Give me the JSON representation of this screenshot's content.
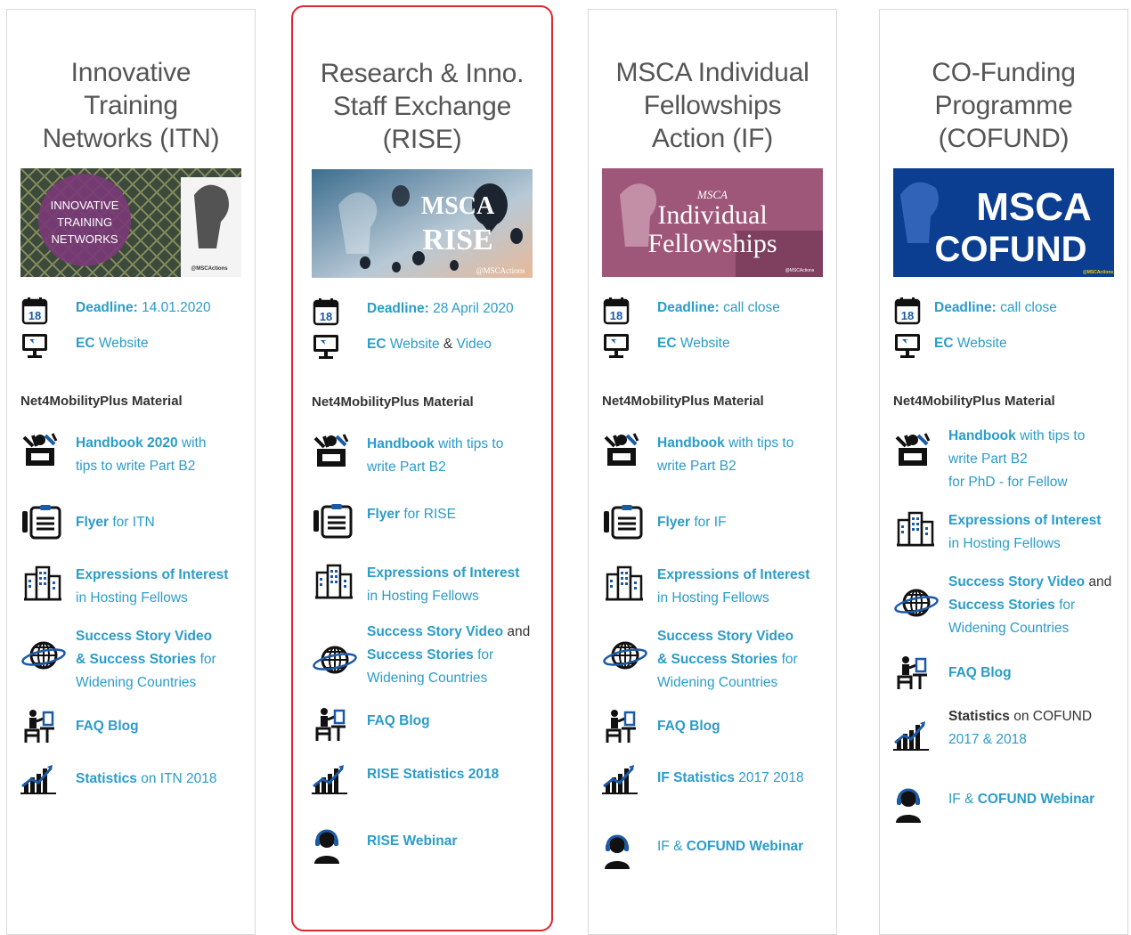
{
  "columns": [
    {
      "title_lines": [
        "Innovative",
        "Training",
        "Networks (ITN)"
      ],
      "banner_text": [
        "INNOVATIVE",
        "TRAINING",
        "NETWORKS"
      ],
      "banner_handle": "@MSCActions",
      "deadline_label": "Deadline:",
      "deadline_value": " 14.01.2020",
      "website_ec": "EC",
      "website_text": " Website",
      "section": "Net4MobilityPlus Material",
      "handbook_bold": "Handbook 2020",
      "handbook_rest": " with",
      "handbook_line2": "tips to write Part B2",
      "flyer_bold": "Flyer",
      "flyer_rest": " for ITN",
      "eoi_bold": "Expressions of Interest",
      "eoi_line2": "in Hosting Fellows",
      "success_line1": "Success Story Video",
      "success_line2_bold": "& Success Stories",
      "success_line2_rest": " for",
      "success_line3": "Widening Countries",
      "faq": "FAQ Blog",
      "stats_bold": "Statistics",
      "stats_rest": " on ITN 2018"
    },
    {
      "title_lines": [
        "Research & Inno.",
        "Staff Exchange",
        "(RISE)"
      ],
      "banner_text": [
        "MSCA",
        "RISE"
      ],
      "banner_handle": "@MSCActions",
      "deadline_label": "Deadline:",
      "deadline_value": " 28 April 2020",
      "website_ec": "EC",
      "website_text": " Website",
      "website_amp": " & ",
      "website_video": "Video",
      "section": "Net4MobilityPlus Material",
      "handbook_bold": "Handbook",
      "handbook_rest": " with tips to",
      "handbook_line2": "write Part B2",
      "flyer_bold": "Flyer",
      "flyer_rest": " for RISE",
      "eoi_bold": "Expressions of Interest",
      "eoi_line2": "in Hosting Fellows",
      "success_line1_bold": "Success Story Video",
      "success_line1_rest": " and",
      "success_line2_bold": "Success Stories",
      "success_line2_rest": " for",
      "success_line3": "Widening Countries",
      "faq": "FAQ Blog",
      "stats": "RISE Statistics 2018",
      "webinar": "RISE Webinar"
    },
    {
      "title_lines": [
        "MSCA Individual",
        "Fellowships",
        "Action (IF)"
      ],
      "banner_text": [
        "MSCA",
        "Individual",
        "Fellowships"
      ],
      "banner_handle": "@MSCActions",
      "deadline_label": "Deadline:",
      "deadline_value": " call close",
      "website_ec": "EC",
      "website_text": " Website",
      "section": "Net4MobilityPlus Material",
      "handbook_bold": "Handbook",
      "handbook_rest": " with tips to",
      "handbook_line2": "write Part B2",
      "flyer_bold": "Flyer",
      "flyer_rest": " for IF",
      "eoi_bold": "Expressions of Interest",
      "eoi_line2": "in Hosting Fellows",
      "success_line1": "Success Story Video",
      "success_line2_bold": "& Success Stories",
      "success_line2_rest": " for",
      "success_line3": "Widening Countries",
      "faq": "FAQ Blog",
      "stats_bold": "IF Statistics",
      "stats_rest": " 2017  2018",
      "webinar_pre": "IF & ",
      "webinar_bold": "COFUND Webinar"
    },
    {
      "title_lines": [
        "CO-Funding",
        "Programme",
        "(COFUND)"
      ],
      "banner_text": [
        "MSCA",
        "COFUND"
      ],
      "banner_handle": "@MSCActions",
      "deadline_label": "Deadline:",
      "deadline_value": " call close",
      "website_ec": "EC",
      "website_text": " Website",
      "section": "Net4MobilityPlus Material",
      "handbook_bold": "Handbook",
      "handbook_rest": " with tips to",
      "handbook_line2": "write Part B2",
      "handbook_line3_a": "for PhD",
      "handbook_line3_sep": " - ",
      "handbook_line3_b": "for Fellow",
      "eoi_bold": "Expressions of Interest",
      "eoi_line2": "in Hosting Fellows",
      "success_line1_bold": "Success Story Video",
      "success_line1_rest": " and",
      "success_line2_bold": "Success Stories",
      "success_line2_rest": " for",
      "success_line3": "Widening Countries",
      "faq": "FAQ Blog",
      "stats_bold": "Statistics",
      "stats_rest": " on COFUND",
      "stats_line2": "2017 & 2018",
      "webinar_pre": "IF & ",
      "webinar_bold": "COFUND Webinar"
    }
  ],
  "icons": {
    "calendar_day": "18"
  },
  "colors": {
    "link": "#2b9cc9",
    "title": "#555555",
    "highlight_border": "#e0262f",
    "cofund_banner": "#0b3d91"
  }
}
